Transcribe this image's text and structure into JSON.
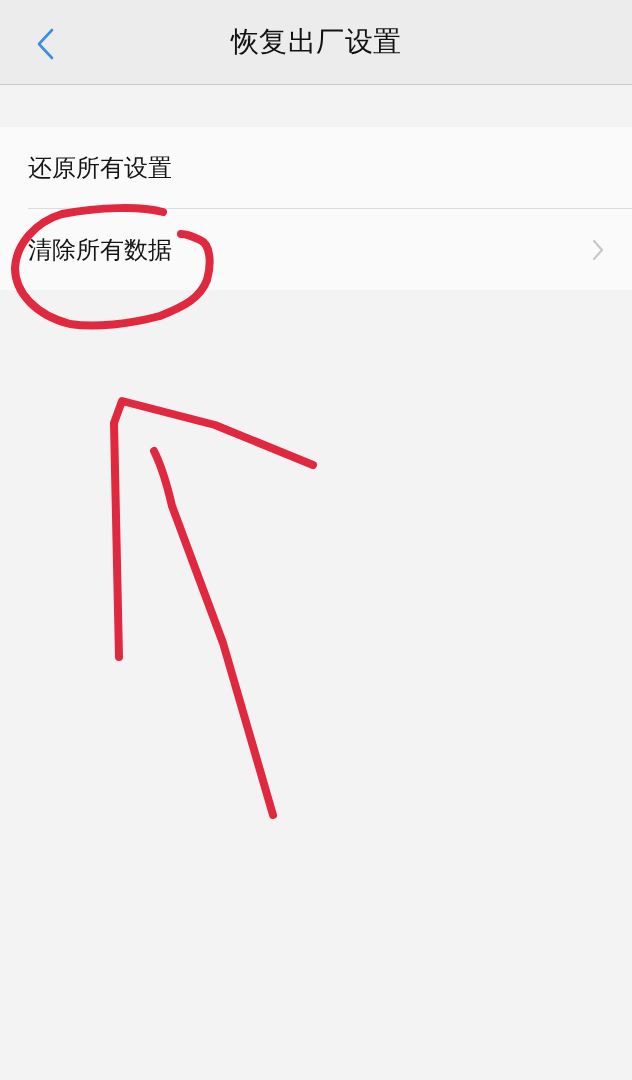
{
  "header": {
    "title": "恢复出厂设置"
  },
  "items": [
    {
      "label": "还原所有设置",
      "kind": "plain"
    },
    {
      "label": "清除所有数据",
      "kind": "link"
    }
  ]
}
